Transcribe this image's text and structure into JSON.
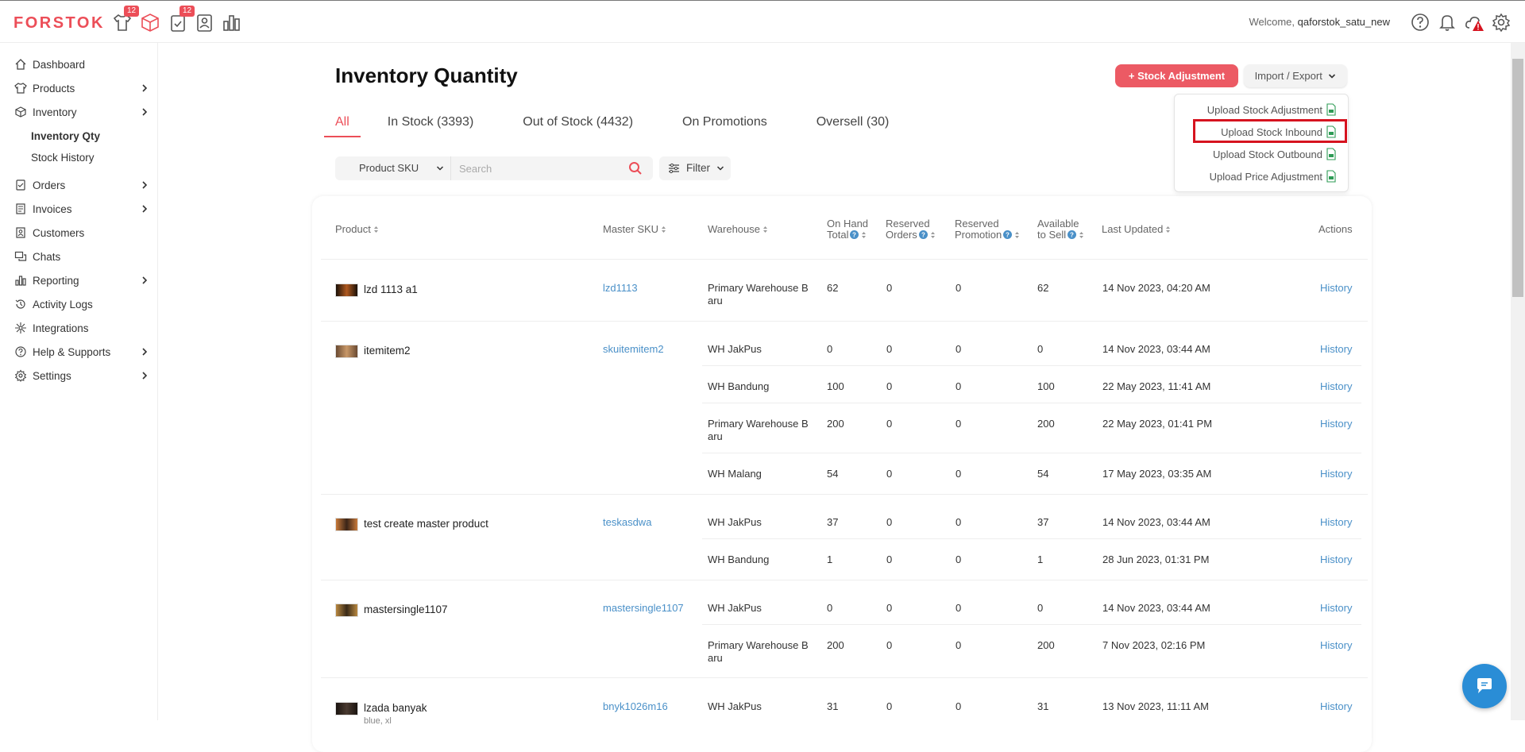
{
  "app": {
    "logo": "FORSTOK",
    "badge1": "12",
    "badge2": "12",
    "welcome_prefix": "Welcome,",
    "username": "qaforstok_satu_new"
  },
  "sidebar": {
    "items": [
      {
        "label": "Dashboard",
        "icon": "home-icon"
      },
      {
        "label": "Products",
        "icon": "shirt-icon"
      },
      {
        "label": "Inventory",
        "icon": "box-icon"
      },
      {
        "label": "Orders",
        "icon": "clipboard-icon"
      },
      {
        "label": "Invoices",
        "icon": "document-icon"
      },
      {
        "label": "Customers",
        "icon": "contact-icon"
      },
      {
        "label": "Chats",
        "icon": "chat-icon"
      },
      {
        "label": "Reporting",
        "icon": "bar-chart-icon"
      },
      {
        "label": "Activity Logs",
        "icon": "history-icon"
      },
      {
        "label": "Integrations",
        "icon": "integration-icon"
      },
      {
        "label": "Help & Supports",
        "icon": "help-icon"
      },
      {
        "label": "Settings",
        "icon": "gear-icon"
      }
    ],
    "subitems": [
      {
        "label": "Inventory Qty",
        "active": true
      },
      {
        "label": "Stock History",
        "active": false
      }
    ]
  },
  "page": {
    "title": "Inventory Quantity",
    "stock_adjustment": "+ Stock Adjustment",
    "import_export": "Import / Export"
  },
  "dropdown": [
    "Upload Stock Adjustment",
    "Upload Stock Inbound",
    "Upload Stock Outbound",
    "Upload Price Adjustment"
  ],
  "tabs": [
    "All",
    "In Stock (3393)",
    "Out of Stock (4432)",
    "On Promotions",
    "Oversell (30)"
  ],
  "search": {
    "select": "Product SKU",
    "placeholder": "Search",
    "filter": "Filter"
  },
  "table": {
    "headers": {
      "product": "Product",
      "master_sku": "Master SKU",
      "warehouse": "Warehouse",
      "on_hand_1": "On Hand",
      "on_hand_2": "Total",
      "reserved_orders_1": "Reserved",
      "reserved_orders_2": "Orders",
      "reserved_promo_1": "Reserved",
      "reserved_promo_2": "Promotion",
      "available_1": "Available",
      "available_2": "to Sell",
      "last_updated": "Last Updated",
      "actions": "Actions"
    },
    "products": [
      {
        "name": "lzd 1113 a1",
        "variant": "",
        "sku": "lzd1113",
        "rows": [
          {
            "warehouse": [
              "Primary Warehouse B",
              "aru"
            ],
            "on_hand": "62",
            "res_orders": "0",
            "res_promo": "0",
            "available": "62",
            "updated": "14 Nov 2023, 04:20 AM",
            "action": "History"
          }
        ]
      },
      {
        "name": "itemitem2",
        "variant": "",
        "sku": "skuitemitem2",
        "rows": [
          {
            "warehouse": [
              "WH JakPus"
            ],
            "on_hand": "0",
            "res_orders": "0",
            "res_promo": "0",
            "available": "0",
            "updated": "14 Nov 2023, 03:44 AM",
            "action": "History"
          },
          {
            "warehouse": [
              "WH Bandung"
            ],
            "on_hand": "100",
            "res_orders": "0",
            "res_promo": "0",
            "available": "100",
            "updated": "22 May 2023, 11:41 AM",
            "action": "History"
          },
          {
            "warehouse": [
              "Primary Warehouse B",
              "aru"
            ],
            "on_hand": "200",
            "res_orders": "0",
            "res_promo": "0",
            "available": "200",
            "updated": "22 May 2023, 01:41 PM",
            "action": "History"
          },
          {
            "warehouse": [
              "WH Malang"
            ],
            "on_hand": "54",
            "res_orders": "0",
            "res_promo": "0",
            "available": "54",
            "updated": "17 May 2023, 03:35 AM",
            "action": "History"
          }
        ]
      },
      {
        "name": "test create master product",
        "variant": "",
        "sku": "teskasdwa",
        "rows": [
          {
            "warehouse": [
              "WH JakPus"
            ],
            "on_hand": "37",
            "res_orders": "0",
            "res_promo": "0",
            "available": "37",
            "updated": "14 Nov 2023, 03:44 AM",
            "action": "History"
          },
          {
            "warehouse": [
              "WH Bandung"
            ],
            "on_hand": "1",
            "res_orders": "0",
            "res_promo": "0",
            "available": "1",
            "updated": "28 Jun 2023, 01:31 PM",
            "action": "History"
          }
        ]
      },
      {
        "name": "mastersingle1107",
        "variant": "",
        "sku": "mastersingle1107",
        "rows": [
          {
            "warehouse": [
              "WH JakPus"
            ],
            "on_hand": "0",
            "res_orders": "0",
            "res_promo": "0",
            "available": "0",
            "updated": "14 Nov 2023, 03:44 AM",
            "action": "History"
          },
          {
            "warehouse": [
              "Primary Warehouse B",
              "aru"
            ],
            "on_hand": "200",
            "res_orders": "0",
            "res_promo": "0",
            "available": "200",
            "updated": "7 Nov 2023, 02:16 PM",
            "action": "History"
          }
        ]
      },
      {
        "name": "lzada banyak",
        "variant": "blue, xl",
        "sku": "bnyk1026m16",
        "rows": [
          {
            "warehouse": [
              "WH JakPus"
            ],
            "on_hand": "31",
            "res_orders": "0",
            "res_promo": "0",
            "available": "31",
            "updated": "13 Nov 2023, 11:11 AM",
            "action": "History"
          }
        ]
      }
    ]
  },
  "colors": {
    "brand": "#ec4e58",
    "link": "#4a90c8",
    "highlight": "#d6131f",
    "chat": "#2a8dd6"
  }
}
